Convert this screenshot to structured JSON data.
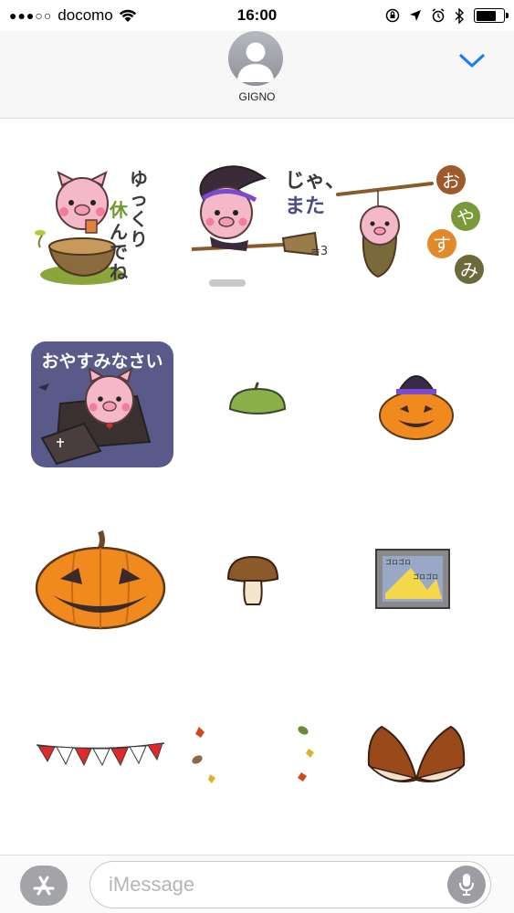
{
  "status_bar": {
    "signal": "●●●○○",
    "carrier": "docomo",
    "time": "16:00",
    "battery_level": 0.75
  },
  "header": {
    "contact_name": "GIGNO"
  },
  "stickers": [
    {
      "name": "pig-on-stump",
      "text": "ゆっくり 休んでね"
    },
    {
      "name": "pig-witch-broom",
      "text": "じゃ、また =3"
    },
    {
      "name": "pig-hanging-branch",
      "text": "お や す み"
    },
    {
      "name": "pig-coffin",
      "text": "おやすみなさい"
    },
    {
      "name": "green-beret",
      "text": ""
    },
    {
      "name": "pumpkin-witch-hat",
      "text": ""
    },
    {
      "name": "jack-o-lantern",
      "text": ""
    },
    {
      "name": "mushroom",
      "text": ""
    },
    {
      "name": "framed-picture",
      "text": "ゴロゴロ ゴロゴロ"
    },
    {
      "name": "bunting-flags",
      "text": ""
    },
    {
      "name": "autumn-leaves-left",
      "text": ""
    },
    {
      "name": "autumn-leaves-right",
      "text": ""
    },
    {
      "name": "chestnuts",
      "text": ""
    }
  ],
  "input": {
    "placeholder": "iMessage"
  },
  "colors": {
    "accent": "#1a7cf5",
    "pumpkin": "#f08a1e",
    "pig": "#f5b8c9"
  }
}
